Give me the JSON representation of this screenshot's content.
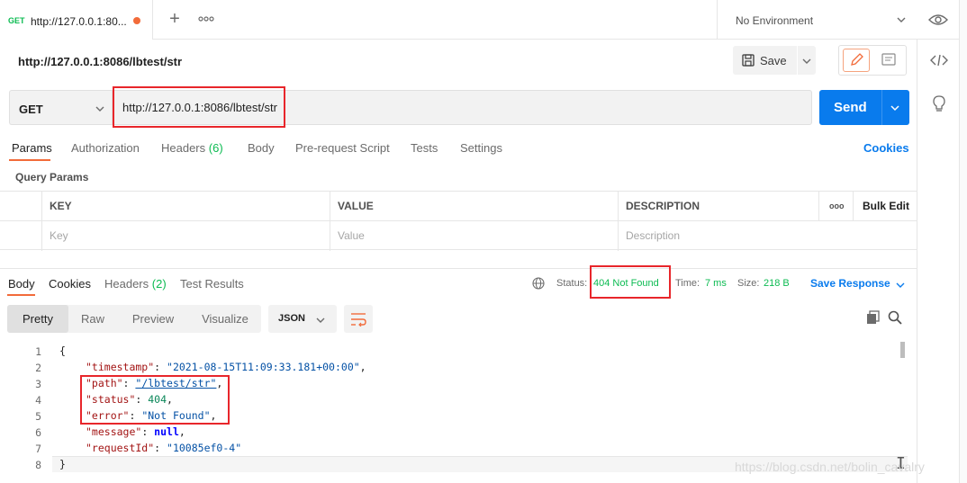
{
  "tabbar": {
    "active_tab": {
      "method": "GET",
      "title": "http://127.0.0.1:80..."
    },
    "add_label": "+",
    "environment": "No Environment"
  },
  "request": {
    "title": "http://127.0.0.1:8086/lbtest/str",
    "save_label": "Save",
    "method": "GET",
    "url": "http://127.0.0.1:8086/lbtest/str",
    "send_label": "Send"
  },
  "request_tabs": [
    {
      "label": "Params"
    },
    {
      "label": "Authorization"
    },
    {
      "label": "Headers",
      "count": "(6)"
    },
    {
      "label": "Body"
    },
    {
      "label": "Pre-request Script"
    },
    {
      "label": "Tests"
    },
    {
      "label": "Settings"
    }
  ],
  "cookies_link": "Cookies",
  "query_params": {
    "title": "Query Params",
    "headers": {
      "key": "KEY",
      "value": "VALUE",
      "description": "DESCRIPTION",
      "more": "ooo",
      "bulk_edit": "Bulk Edit"
    },
    "placeholders": {
      "key": "Key",
      "value": "Value",
      "description": "Description"
    }
  },
  "response_tabs": [
    {
      "label": "Body"
    },
    {
      "label": "Cookies"
    },
    {
      "label": "Headers",
      "count": "(2)"
    },
    {
      "label": "Test Results"
    }
  ],
  "response_meta": {
    "status_label": "Status:",
    "status_value": "404 Not Found",
    "time_label": "Time:",
    "time_value": "7 ms",
    "size_label": "Size:",
    "size_value": "218 B",
    "save_response": "Save Response"
  },
  "view_modes": [
    "Pretty",
    "Raw",
    "Preview",
    "Visualize"
  ],
  "format": "JSON",
  "code": {
    "line_numbers": [
      "1",
      "2",
      "3",
      "4",
      "5",
      "6",
      "7",
      "8"
    ],
    "open": "{",
    "close": "}",
    "timestamp_key": "\"timestamp\"",
    "timestamp_val": "\"2021-08-15T11:09:33.181+00:00\"",
    "path_key": "\"path\"",
    "path_val": "\"/lbtest/str\"",
    "status_key": "\"status\"",
    "status_val": "404",
    "error_key": "\"error\"",
    "error_val": "\"Not Found\"",
    "message_key": "\"message\"",
    "message_val": "null",
    "requestId_key": "\"requestId\"",
    "requestId_val": "\"10085ef0-4\"",
    "colon": ": ",
    "comma": ","
  },
  "watermark": "https://blog.csdn.net/bolin_cavalry",
  "colors": {
    "accent": "#f26b3a",
    "send": "#097bed",
    "success": "#0cbb52",
    "highlight": "#e8262b"
  }
}
